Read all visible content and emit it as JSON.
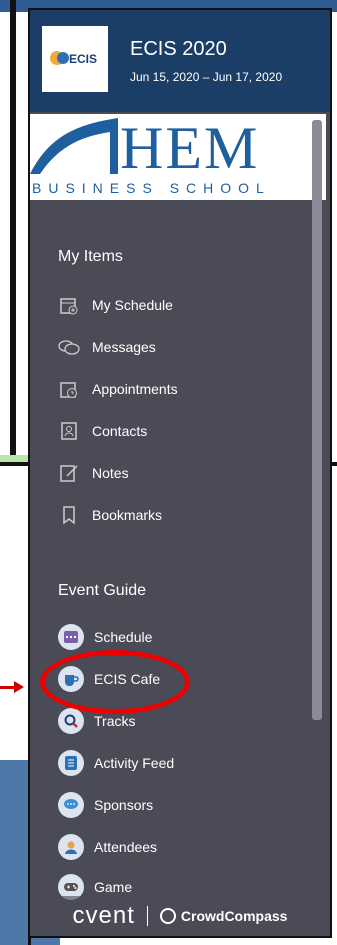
{
  "event": {
    "title": "ECIS 2020",
    "dates": "Jun 15, 2020 – Jun 17, 2020",
    "logo_text": "ECIS"
  },
  "sponsor": {
    "name_big": "HEM",
    "name_sub": "BUSINESS SCHOOL"
  },
  "my_items": {
    "heading": "My Items",
    "items": [
      {
        "label": "My Schedule",
        "icon": "calendar-plus-icon"
      },
      {
        "label": "Messages",
        "icon": "chat-bubbles-icon"
      },
      {
        "label": "Appointments",
        "icon": "calendar-clock-icon"
      },
      {
        "label": "Contacts",
        "icon": "contact-card-icon"
      },
      {
        "label": "Notes",
        "icon": "note-pencil-icon"
      },
      {
        "label": "Bookmarks",
        "icon": "bookmark-icon"
      }
    ]
  },
  "event_guide": {
    "heading": "Event Guide",
    "items": [
      {
        "label": "Schedule",
        "icon": "calendar-icon"
      },
      {
        "label": "ECIS Cafe",
        "icon": "cafe-cup-icon"
      },
      {
        "label": "Tracks",
        "icon": "magnifier-icon"
      },
      {
        "label": "Activity Feed",
        "icon": "feed-list-icon"
      },
      {
        "label": "Sponsors",
        "icon": "sponsor-chat-icon"
      },
      {
        "label": "Attendees",
        "icon": "people-icon"
      },
      {
        "label": "Game",
        "icon": "gamepad-icon"
      }
    ]
  },
  "footer": {
    "brand": "cvent",
    "partner": "CrowdCompass"
  },
  "colors": {
    "header": "#1b3e66",
    "panel": "#4a4b56",
    "highlight": "#e00000"
  }
}
